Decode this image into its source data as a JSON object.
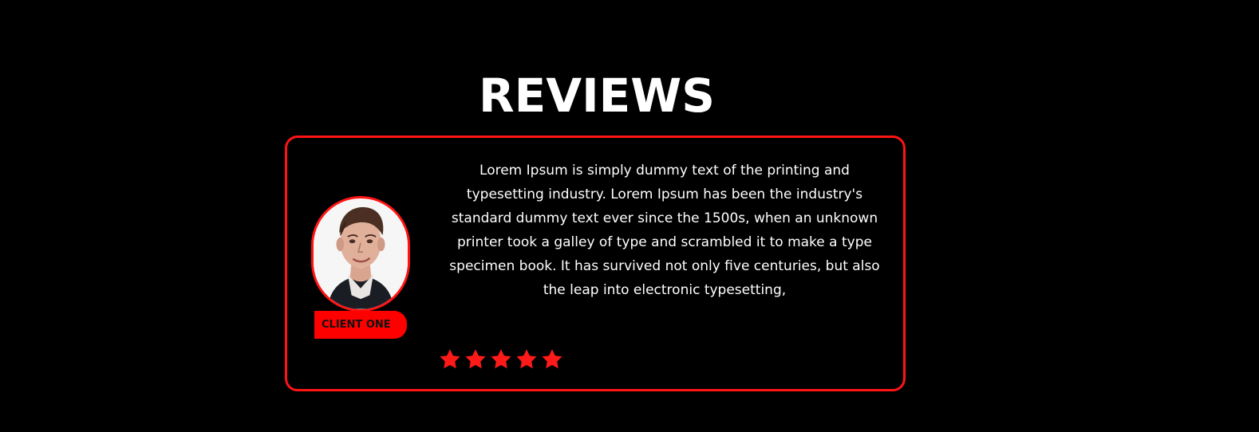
{
  "section": {
    "title": "REVIEWS"
  },
  "review": {
    "client_name": "CLIENT ONE",
    "text": "Lorem Ipsum is simply dummy text of the printing and typesetting industry. Lorem Ipsum has been the industry's standard dummy text ever since the 1500s, when an unknown printer took a galley of type and scrambled it to make a type specimen book. It has survived not only five centuries, but also the leap into electronic typesetting,",
    "rating": 5,
    "rating_max": 5,
    "avatar_icon": "client-photo"
  },
  "colors": {
    "background": "#000000",
    "accent": "#ff1414",
    "text": "#ffffff"
  }
}
